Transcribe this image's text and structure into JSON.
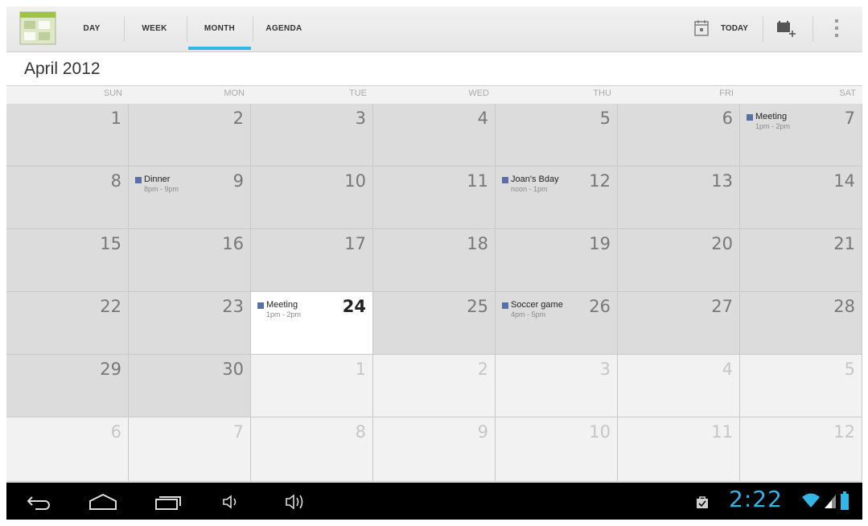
{
  "actionbar": {
    "tabs": [
      {
        "label": "DAY"
      },
      {
        "label": "WEEK"
      },
      {
        "label": "MONTH",
        "active": true
      },
      {
        "label": "AGENDA"
      }
    ],
    "today_label": "TODAY",
    "icons": [
      "calendar-app-icon",
      "today-calendar-icon",
      "new-event-icon",
      "overflow-menu-icon"
    ]
  },
  "month_title": "April 2012",
  "weekdays": [
    "SUN",
    "MON",
    "TUE",
    "WED",
    "THU",
    "FRI",
    "SAT"
  ],
  "weeks": [
    [
      {
        "day": "1"
      },
      {
        "day": "2"
      },
      {
        "day": "3"
      },
      {
        "day": "4"
      },
      {
        "day": "5"
      },
      {
        "day": "6"
      },
      {
        "day": "7",
        "event": {
          "title": "Meeting",
          "time": "1pm - 2pm"
        }
      }
    ],
    [
      {
        "day": "8"
      },
      {
        "day": "9",
        "event": {
          "title": "Dinner",
          "time": "8pm - 9pm"
        }
      },
      {
        "day": "10"
      },
      {
        "day": "11"
      },
      {
        "day": "12",
        "event": {
          "title": "Joan's Bday",
          "time": "noon - 1pm"
        }
      },
      {
        "day": "13"
      },
      {
        "day": "14"
      }
    ],
    [
      {
        "day": "15"
      },
      {
        "day": "16"
      },
      {
        "day": "17"
      },
      {
        "day": "18"
      },
      {
        "day": "19"
      },
      {
        "day": "20"
      },
      {
        "day": "21"
      }
    ],
    [
      {
        "day": "22"
      },
      {
        "day": "23"
      },
      {
        "day": "24",
        "today": true,
        "event": {
          "title": "Meeting",
          "time": "1pm - 2pm"
        }
      },
      {
        "day": "25"
      },
      {
        "day": "26",
        "event": {
          "title": "Soccer game",
          "time": "4pm - 5pm"
        }
      },
      {
        "day": "27"
      },
      {
        "day": "28"
      }
    ],
    [
      {
        "day": "29"
      },
      {
        "day": "30"
      },
      {
        "day": "1",
        "other": true
      },
      {
        "day": "2",
        "other": true
      },
      {
        "day": "3",
        "other": true
      },
      {
        "day": "4",
        "other": true
      },
      {
        "day": "5",
        "other": true
      }
    ],
    [
      {
        "day": "6",
        "other": true
      },
      {
        "day": "7",
        "other": true
      },
      {
        "day": "8",
        "other": true
      },
      {
        "day": "9",
        "other": true
      },
      {
        "day": "10",
        "other": true
      },
      {
        "day": "11",
        "other": true
      },
      {
        "day": "12",
        "other": true
      }
    ]
  ],
  "colors": {
    "accent": "#33b5e5",
    "event": "#5a6fa3",
    "cell_current": "#dcdcdc",
    "cell_other": "#f2f2f2",
    "cell_today": "#ffffff"
  },
  "system_bar": {
    "clock": "2:22",
    "icons": [
      "back-icon",
      "home-icon",
      "recent-apps-icon",
      "volume-down-icon",
      "volume-up-icon",
      "notification-bag-icon",
      "wifi-icon",
      "signal-icon",
      "battery-icon"
    ]
  }
}
